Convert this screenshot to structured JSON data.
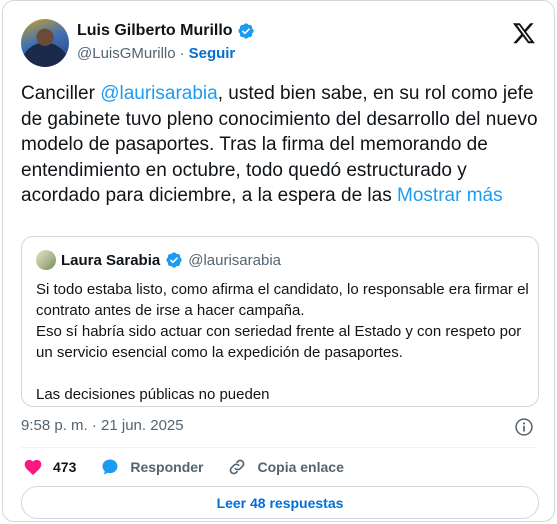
{
  "author": {
    "name": "Luis Gilberto Murillo",
    "handle": "@LuisGMurillo",
    "separator": "·",
    "follow_label": "Seguir"
  },
  "tweet": {
    "text_part1": "Canciller ",
    "mention": "@laurisarabia",
    "text_part2": ", usted bien sabe, en su rol como jefe de gabinete tuvo pleno conocimiento del desarrollo del nuevo modelo de pasaportes. Tras la firma del memorando de entendimiento en octubre, todo quedó estructurado y acordado para diciembre, a la espera de las ",
    "show_more": "Mostrar más"
  },
  "quote": {
    "name": "Laura Sarabia",
    "handle": "@laurisarabia",
    "paragraph1": "Si todo estaba listo, como afirma el candidato, lo responsable era firmar el contrato antes de irse a hacer campaña.\nEso sí habría sido actuar con seriedad frente al Estado y con respeto por un servicio esencial como la expedición de pasaportes.",
    "paragraph2": "Las decisiones públicas no pueden"
  },
  "meta": {
    "timestamp": "9:58 p. m. · 21 jun. 2025"
  },
  "actions": {
    "likes": "473",
    "reply_label": "Responder",
    "copy_label": "Copia enlace"
  },
  "read_replies": "Leer 48 respuestas",
  "colors": {
    "link": "#1d9bf0",
    "like": "#f91880",
    "verified": "#1d9bf0",
    "muted": "#536471"
  },
  "icons": [
    "verified-badge-icon",
    "x-logo-icon",
    "info-icon",
    "heart-icon",
    "reply-bubble-icon",
    "link-icon"
  ]
}
